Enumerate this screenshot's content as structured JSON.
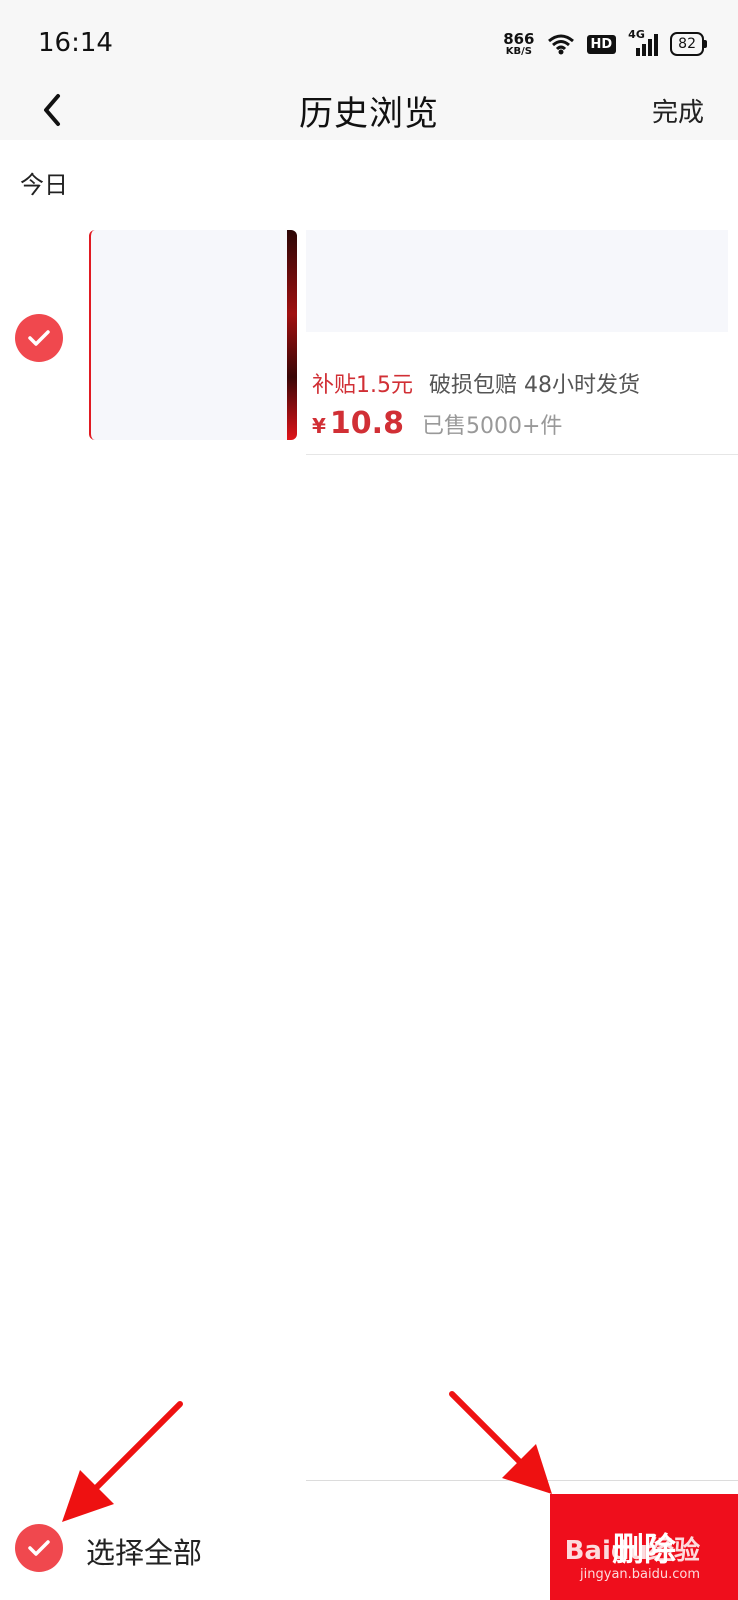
{
  "status_bar": {
    "time": "16:14",
    "net_speed_value": "866",
    "net_speed_unit": "KB/S",
    "hd_badge": "HD",
    "network_type": "4G",
    "battery_level": "82"
  },
  "nav": {
    "title": "历史浏览",
    "done_label": "完成"
  },
  "section": {
    "date_label": "今日"
  },
  "items": [
    {
      "selected": true,
      "subsidy_tag": "补贴1.5元",
      "service_tags": "破损包赔 48小时发货",
      "currency": "¥",
      "price": "10.8",
      "sold": "已售5000+件"
    }
  ],
  "bottom_bar": {
    "select_all_label": "选择全部",
    "select_all_checked": true,
    "delete_label": "删除"
  },
  "watermark": {
    "brand": "Baidu经验",
    "url": "jingyan.baidu.com"
  },
  "colors": {
    "accent_red": "#ef0e1c",
    "check_red": "#f0484e",
    "price_red": "#d12f35",
    "placeholder_bg": "#f6f7fb"
  }
}
